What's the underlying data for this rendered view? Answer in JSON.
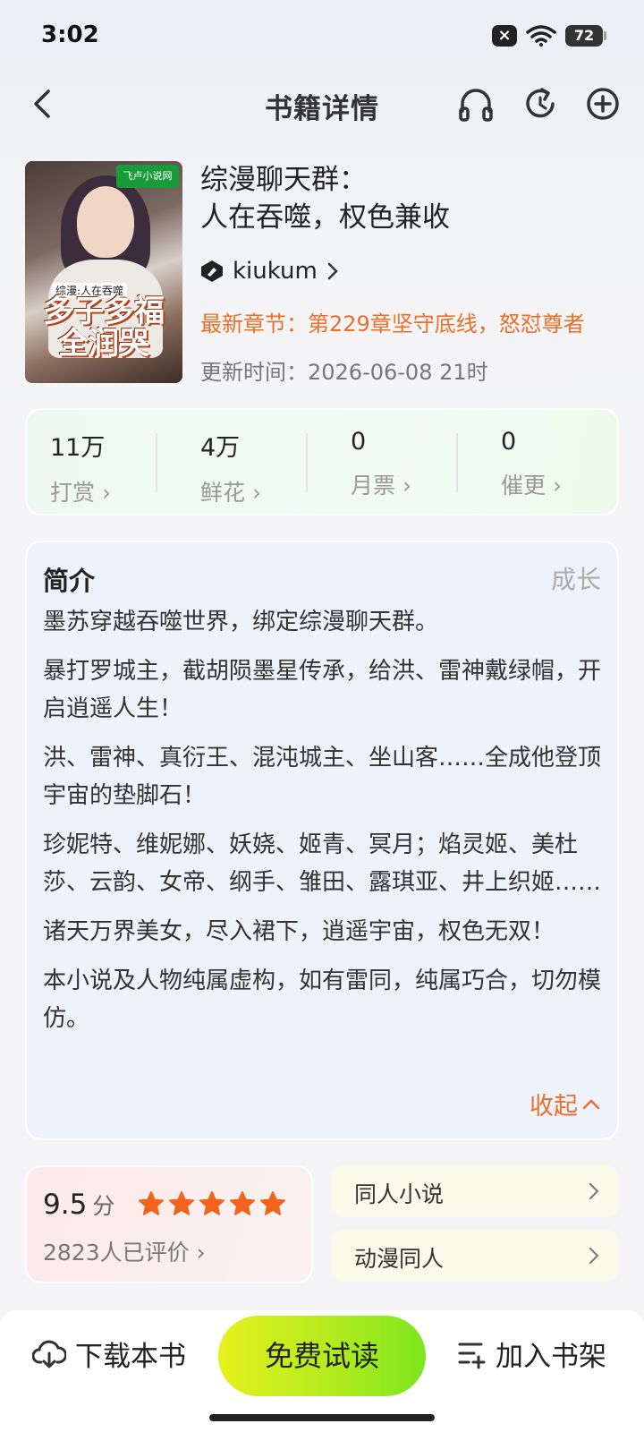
{
  "status": {
    "time": "3:02",
    "battery": "72",
    "close_glyph": "×"
  },
  "nav": {
    "title": "书籍详情"
  },
  "book": {
    "title_line1": "综漫聊天群：",
    "title_line2": "人在吞噬，权色兼收",
    "author": "kiukum",
    "latest_chapter": "最新章节：第229章坚守底线，怒怼尊者",
    "updated": "更新时间：2026-06-08 21时",
    "cover": {
      "badge": "飞卢小说网",
      "subtitle": "综漫:人在吞噬",
      "title": "多子多福全润哭"
    }
  },
  "stats": [
    {
      "value": "11万",
      "label": "打赏 ›"
    },
    {
      "value": "4万",
      "label": "鲜花 ›"
    },
    {
      "value": "0",
      "label": "月票 ›"
    },
    {
      "value": "0",
      "label": "催更 ›"
    }
  ],
  "intro": {
    "title": "简介",
    "tag": "成长",
    "paragraphs": [
      "墨苏穿越吞噬世界，绑定综漫聊天群。",
      "暴打罗城主，截胡陨墨星传承，给洪、雷神戴绿帽，开启逍遥人生！",
      "洪、雷神、真衍王、混沌城主、坐山客……全成他登顶宇宙的垫脚石！",
      "珍妮特、维妮娜、妖娆、姬青、冥月；焰灵姬、美杜莎、云韵、女帝、纲手、雏田、露琪亚、井上织姬……",
      "诸天万界美女，尽入裙下，逍遥宇宙，权色无双！",
      "本小说及人物纯属虚构，如有雷同，纯属巧合，切勿模仿。"
    ],
    "collapse": "收起"
  },
  "rating": {
    "score": "9.5",
    "unit": "分",
    "stars": 5,
    "count": "2823人已评价 ›"
  },
  "tags": [
    "同人小说",
    "动漫同人"
  ],
  "bottom": {
    "download": "下载本书",
    "read": "免费试读",
    "shelf": "加入书架"
  },
  "colors": {
    "accent": "#e8702a",
    "star": "#f2631b",
    "read_start": "#e7f01c",
    "read_end": "#7ee61e"
  }
}
